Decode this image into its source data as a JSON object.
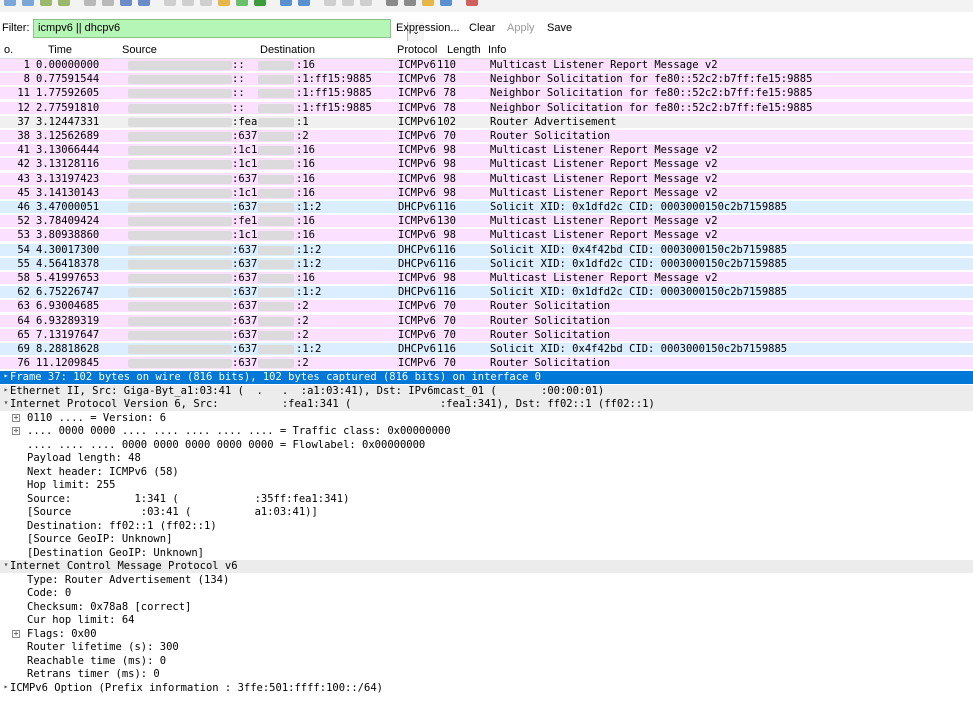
{
  "filter": {
    "label": "Filter:",
    "value": "icmpv6 || dhcpv6",
    "buttons": [
      "Expression...",
      "Clear",
      "Apply",
      "Save"
    ]
  },
  "columns": [
    "o.",
    "Time",
    "Source",
    "Destination",
    "Protocol",
    "Length",
    "Info"
  ],
  "colors": {
    "icmpv6_row": "#fce0ff",
    "dhcpv6_row": "#daeeff",
    "selected": "#0078d7",
    "filter_ok": "#b5f5b5"
  },
  "packets": [
    {
      "no": "1",
      "time": "0.00000000",
      "src": "::",
      "dst": ":16",
      "proto": "ICMPv6",
      "len": "110",
      "info": "Multicast Listener Report Message v2"
    },
    {
      "no": "8",
      "time": "0.77591544",
      "src": "::",
      "dst": ":1:ff15:9885",
      "proto": "ICMPv6",
      "len": "78",
      "info": "Neighbor Solicitation for fe80::52c2:b7ff:fe15:9885"
    },
    {
      "no": "11",
      "time": "1.77592605",
      "src": "::",
      "dst": ":1:ff15:9885",
      "proto": "ICMPv6",
      "len": "78",
      "info": "Neighbor Solicitation for fe80::52c2:b7ff:fe15:9885"
    },
    {
      "no": "12",
      "time": "2.77591810",
      "src": "::",
      "dst": ":1:ff15:9885",
      "proto": "ICMPv6",
      "len": "78",
      "info": "Neighbor Solicitation for fe80::52c2:b7ff:fe15:9885"
    },
    {
      "no": "37",
      "time": "3.12447331",
      "src": ":fea",
      "dst": ":1",
      "proto": "ICMPv6",
      "len": "102",
      "info": "Router Advertisement"
    },
    {
      "no": "38",
      "time": "3.12562689",
      "src": ":637",
      "dst": ":2",
      "proto": "ICMPv6",
      "len": "70",
      "info": "Router Solicitation"
    },
    {
      "no": "41",
      "time": "3.13066444",
      "src": ":1c1",
      "dst": ":16",
      "proto": "ICMPv6",
      "len": "98",
      "info": "Multicast Listener Report Message v2"
    },
    {
      "no": "42",
      "time": "3.13128116",
      "src": ":1c1",
      "dst": ":16",
      "proto": "ICMPv6",
      "len": "98",
      "info": "Multicast Listener Report Message v2"
    },
    {
      "no": "43",
      "time": "3.13197423",
      "src": ":637",
      "dst": ":16",
      "proto": "ICMPv6",
      "len": "98",
      "info": "Multicast Listener Report Message v2"
    },
    {
      "no": "45",
      "time": "3.14130143",
      "src": ":1c1",
      "dst": ":16",
      "proto": "ICMPv6",
      "len": "98",
      "info": "Multicast Listener Report Message v2"
    },
    {
      "no": "46",
      "time": "3.47000051",
      "src": ":637",
      "dst": ":1:2",
      "proto": "DHCPv6",
      "len": "116",
      "info": "Solicit XID: 0x1dfd2c CID: 0003000150c2b7159885"
    },
    {
      "no": "52",
      "time": "3.78409424",
      "src": ":fe1",
      "dst": ":16",
      "proto": "ICMPv6",
      "len": "130",
      "info": "Multicast Listener Report Message v2"
    },
    {
      "no": "53",
      "time": "3.80938860",
      "src": ":1c1",
      "dst": ":16",
      "proto": "ICMPv6",
      "len": "98",
      "info": "Multicast Listener Report Message v2"
    },
    {
      "no": "54",
      "time": "4.30017300",
      "src": ":637",
      "dst": ":1:2",
      "proto": "DHCPv6",
      "len": "116",
      "info": "Solicit XID: 0x4f42bd CID: 0003000150c2b7159885"
    },
    {
      "no": "55",
      "time": "4.56418378",
      "src": ":637",
      "dst": ":1:2",
      "proto": "DHCPv6",
      "len": "116",
      "info": "Solicit XID: 0x1dfd2c CID: 0003000150c2b7159885"
    },
    {
      "no": "58",
      "time": "5.41997653",
      "src": ":637",
      "dst": ":16",
      "proto": "ICMPv6",
      "len": "98",
      "info": "Multicast Listener Report Message v2"
    },
    {
      "no": "62",
      "time": "6.75226747",
      "src": ":637",
      "dst": ":1:2",
      "proto": "DHCPv6",
      "len": "116",
      "info": "Solicit XID: 0x1dfd2c CID: 0003000150c2b7159885"
    },
    {
      "no": "63",
      "time": "6.93004685",
      "src": ":637",
      "dst": ":2",
      "proto": "ICMPv6",
      "len": "70",
      "info": "Router Solicitation"
    },
    {
      "no": "64",
      "time": "6.93289319",
      "src": ":637",
      "dst": ":2",
      "proto": "ICMPv6",
      "len": "70",
      "info": "Router Solicitation"
    },
    {
      "no": "65",
      "time": "7.13197647",
      "src": ":637",
      "dst": ":2",
      "proto": "ICMPv6",
      "len": "70",
      "info": "Router Solicitation"
    },
    {
      "no": "69",
      "time": "8.28818628",
      "src": ":637",
      "dst": ":1:2",
      "proto": "DHCPv6",
      "len": "116",
      "info": "Solicit XID: 0x4f42bd CID: 0003000150c2b7159885"
    },
    {
      "no": "76",
      "time": "11.1209845",
      "src": ":637",
      "dst": ":2",
      "proto": "ICMPv6",
      "len": "70",
      "info": "Router Solicitation"
    }
  ],
  "details": [
    {
      "text": "Frame 37: 102 bytes on wire (816 bits), 102 bytes captured (816 bits) on interface 0",
      "indent": 0,
      "state": "collapsed",
      "style": "selected"
    },
    {
      "text": "Ethernet II, Src: Giga-Byt_a1:03:41 (  .   .  :a1:03:41), Dst: IPv6mcast_01 (       :00:00:01)",
      "indent": 0,
      "state": "collapsed",
      "style": "group"
    },
    {
      "text": "Internet Protocol Version 6, Src:          :fea1:341 (              :fea1:341), Dst: ff02::1 (ff02::1)",
      "indent": 0,
      "state": "expanded",
      "style": "group"
    },
    {
      "text": "0110 .... = Version: 6",
      "indent": 1,
      "state": "collapsed",
      "style": ""
    },
    {
      "text": ".... 0000 0000 .... .... .... .... .... = Traffic class: 0x00000000",
      "indent": 1,
      "state": "collapsed",
      "style": ""
    },
    {
      "text": ".... .... .... 0000 0000 0000 0000 0000 = Flowlabel: 0x00000000",
      "indent": 1,
      "state": "none",
      "style": ""
    },
    {
      "text": "Payload length: 48",
      "indent": 1,
      "state": "none",
      "style": ""
    },
    {
      "text": "Next header: ICMPv6 (58)",
      "indent": 1,
      "state": "none",
      "style": ""
    },
    {
      "text": "Hop limit: 255",
      "indent": 1,
      "state": "none",
      "style": ""
    },
    {
      "text": "Source:          1:341 (            :35ff:fea1:341)",
      "indent": 1,
      "state": "none",
      "style": ""
    },
    {
      "text": "[Source           :03:41 (          a1:03:41)]",
      "indent": 1,
      "state": "none",
      "style": ""
    },
    {
      "text": "Destination: ff02::1 (ff02::1)",
      "indent": 1,
      "state": "none",
      "style": ""
    },
    {
      "text": "[Source GeoIP: Unknown]",
      "indent": 1,
      "state": "none",
      "style": ""
    },
    {
      "text": "[Destination GeoIP: Unknown]",
      "indent": 1,
      "state": "none",
      "style": ""
    },
    {
      "text": "Internet Control Message Protocol v6",
      "indent": 0,
      "state": "expanded",
      "style": "group"
    },
    {
      "text": "Type: Router Advertisement (134)",
      "indent": 1,
      "state": "none",
      "style": ""
    },
    {
      "text": "Code: 0",
      "indent": 1,
      "state": "none",
      "style": ""
    },
    {
      "text": "Checksum: 0x78a8 [correct]",
      "indent": 1,
      "state": "none",
      "style": ""
    },
    {
      "text": "Cur hop limit: 64",
      "indent": 1,
      "state": "none",
      "style": ""
    },
    {
      "text": "Flags: 0x00",
      "indent": 1,
      "state": "collapsed",
      "style": ""
    },
    {
      "text": "Router lifetime (s): 300",
      "indent": 1,
      "state": "none",
      "style": ""
    },
    {
      "text": "Reachable time (ms): 0",
      "indent": 1,
      "state": "none",
      "style": ""
    },
    {
      "text": "Retrans timer (ms): 0",
      "indent": 1,
      "state": "none",
      "style": ""
    },
    {
      "text": "ICMPv6 Option (Prefix information : 3ffe:501:ffff:100::/64)",
      "indent": 0,
      "state": "collapsed",
      "style": ""
    }
  ]
}
